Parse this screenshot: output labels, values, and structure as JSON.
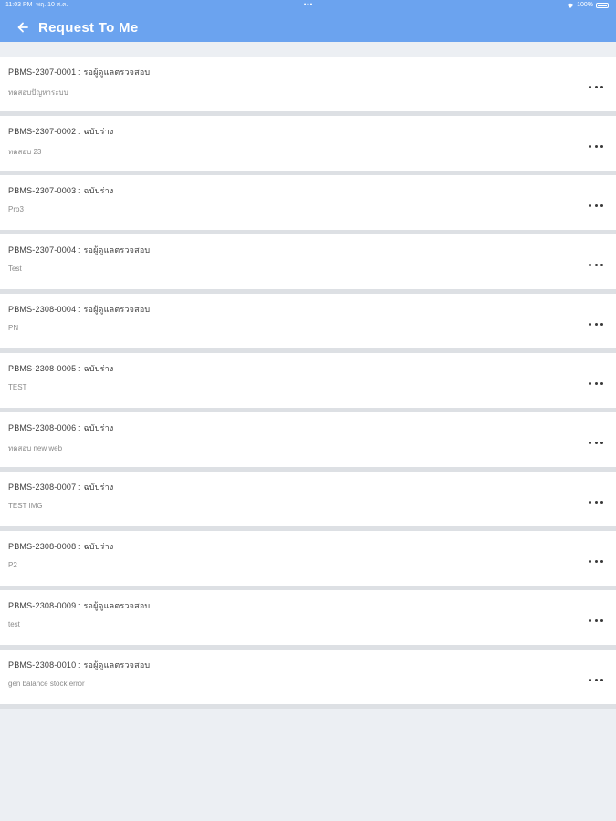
{
  "status": {
    "time": "11:03 PM",
    "date": "พฤ. 10 ส.ค.",
    "center": "•••",
    "battery": "100%"
  },
  "header": {
    "back_icon": "arrow-left-icon",
    "title": "Request To Me",
    "color": "#6ba3ef"
  },
  "requests": [
    {
      "title": "PBMS-2307-0001 : รอผู้ดูแลตรวจสอบ",
      "subtitle": "ทดสอบปัญหาระบบ"
    },
    {
      "title": "PBMS-2307-0002 : ฉบับร่าง",
      "subtitle": "ทดสอบ 23"
    },
    {
      "title": "PBMS-2307-0003 : ฉบับร่าง",
      "subtitle": "Pro3"
    },
    {
      "title": "PBMS-2307-0004 : รอผู้ดูแลตรวจสอบ",
      "subtitle": "Test"
    },
    {
      "title": "PBMS-2308-0004 : รอผู้ดูแลตรวจสอบ",
      "subtitle": "PN"
    },
    {
      "title": "PBMS-2308-0005 : ฉบับร่าง",
      "subtitle": "TEST"
    },
    {
      "title": "PBMS-2308-0006 : ฉบับร่าง",
      "subtitle": "ทดสอบ new web"
    },
    {
      "title": "PBMS-2308-0007 : ฉบับร่าง",
      "subtitle": "TEST IMG"
    },
    {
      "title": "PBMS-2308-0008 : ฉบับร่าง",
      "subtitle": "P2"
    },
    {
      "title": "PBMS-2308-0009 : รอผู้ดูแลตรวจสอบ",
      "subtitle": "test"
    },
    {
      "title": "PBMS-2308-0010 : รอผู้ดูแลตรวจสอบ",
      "subtitle": "gen balance stock error"
    }
  ],
  "more_icon": "more-horizontal-icon"
}
